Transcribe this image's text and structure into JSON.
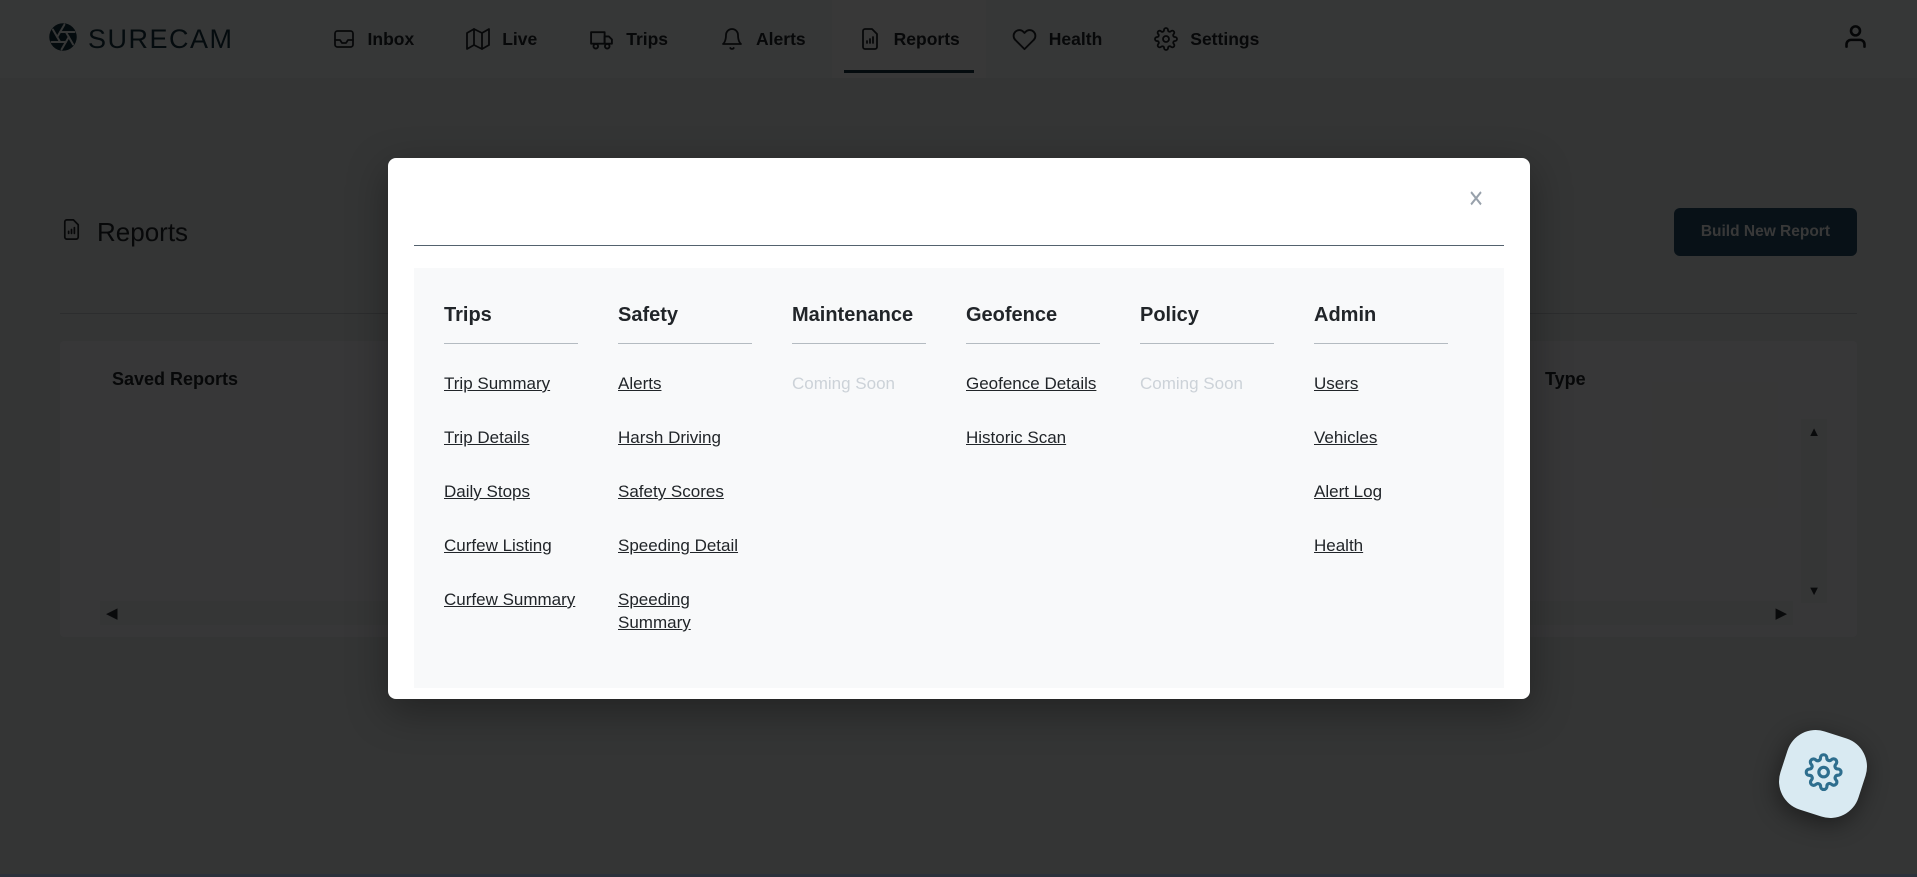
{
  "brand": {
    "name": "SURECAM",
    "accent_color": "#16323f"
  },
  "nav": {
    "items": [
      {
        "label": "Inbox",
        "icon": "inbox-icon"
      },
      {
        "label": "Live",
        "icon": "map-icon"
      },
      {
        "label": "Trips",
        "icon": "truck-icon"
      },
      {
        "label": "Alerts",
        "icon": "bell-icon"
      },
      {
        "label": "Reports",
        "icon": "report-file-icon",
        "active": true
      },
      {
        "label": "Health",
        "icon": "heart-icon"
      },
      {
        "label": "Settings",
        "icon": "gear-icon"
      }
    ],
    "user_icon": "person-icon"
  },
  "page": {
    "title": "Reports",
    "build_new_report_label": "Build New Report",
    "saved_reports": {
      "title": "Saved Reports",
      "type_column": "Type",
      "scroll_icons": {
        "up": "▲",
        "down": "▼",
        "left": "◀",
        "right": "▶"
      }
    }
  },
  "modal": {
    "close_icon": "✕",
    "columns": [
      {
        "title": "Trips",
        "links": [
          "Trip Summary",
          "Trip Details",
          "Daily Stops",
          "Curfew Listing",
          "Curfew Summary"
        ]
      },
      {
        "title": "Safety",
        "links": [
          "Alerts",
          "Harsh Driving",
          "Safety Scores",
          "Speeding Detail",
          "Speeding Summary"
        ]
      },
      {
        "title": "Maintenance",
        "coming_soon": "Coming Soon",
        "links": []
      },
      {
        "title": "Geofence",
        "links": [
          "Geofence Details",
          "Historic Scan"
        ]
      },
      {
        "title": "Policy",
        "coming_soon": "Coming Soon",
        "links": []
      },
      {
        "title": "Admin",
        "links": [
          "Users",
          "Vehicles",
          "Alert Log",
          "Health"
        ]
      }
    ]
  },
  "fab": {
    "bg": "#d9eaf2",
    "icon_color": "#2e6e8e",
    "icon": "gear-icon"
  },
  "colors": {
    "overlay": "rgba(0,0,0,0.78)",
    "link_text": "#212529",
    "coming_soon_text": "#ccd2d8",
    "modal_divider": "#54626e",
    "column_underline": "#b4bbc1",
    "build_button_bg": "#24506a"
  }
}
